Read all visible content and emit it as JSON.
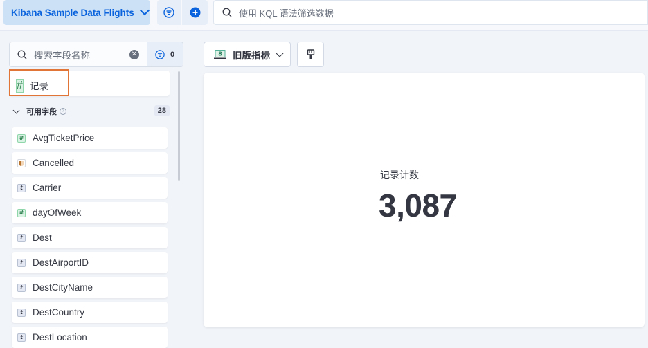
{
  "topbar": {
    "data_view": "Kibana Sample Data Flights",
    "query_placeholder": "使用 KQL 语法筛选数据"
  },
  "sidebar": {
    "search_placeholder": "搜索字段名称",
    "filter_count": "0",
    "records_label": "记录",
    "available_label": "可用字段",
    "available_count": "28",
    "fields": [
      {
        "name": "AvgTicketPrice",
        "type": "number"
      },
      {
        "name": "Cancelled",
        "type": "boolean"
      },
      {
        "name": "Carrier",
        "type": "string"
      },
      {
        "name": "dayOfWeek",
        "type": "number"
      },
      {
        "name": "Dest",
        "type": "string"
      },
      {
        "name": "DestAirportID",
        "type": "string"
      },
      {
        "name": "DestCityName",
        "type": "string"
      },
      {
        "name": "DestCountry",
        "type": "string"
      },
      {
        "name": "DestLocation",
        "type": "geo"
      }
    ]
  },
  "toolbar": {
    "legacy_metric_label": "旧版指标"
  },
  "metric": {
    "label": "记录计数",
    "value": "3,087"
  },
  "colors": {
    "accent": "#0b64dd",
    "highlight": "#e17537"
  }
}
